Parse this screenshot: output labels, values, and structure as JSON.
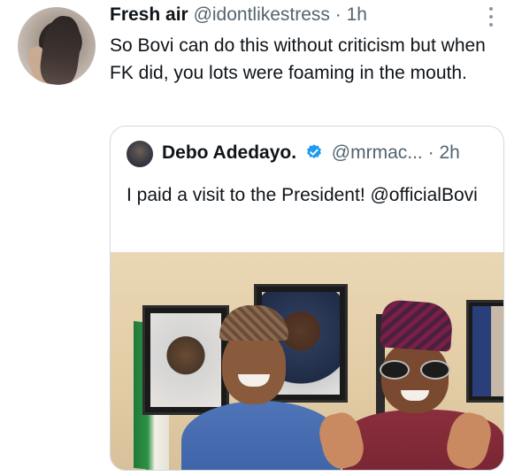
{
  "tweet": {
    "author_name": "Fresh air",
    "author_handle": "@idontlikestress",
    "separator": "·",
    "time": "1h",
    "text": "So Bovi can do this without criticism but when FK did, you lots were foaming in the mouth.",
    "more_icon": "more-vertical-icon"
  },
  "quoted": {
    "author_name": "Debo Adedayo.",
    "verified_icon": "verified-badge-icon",
    "author_handle": "@mrmac...",
    "separator": "·",
    "time": "2h",
    "text": "I paid a visit to the President! @officialBovi",
    "verified_color": "#1d9bf0"
  }
}
